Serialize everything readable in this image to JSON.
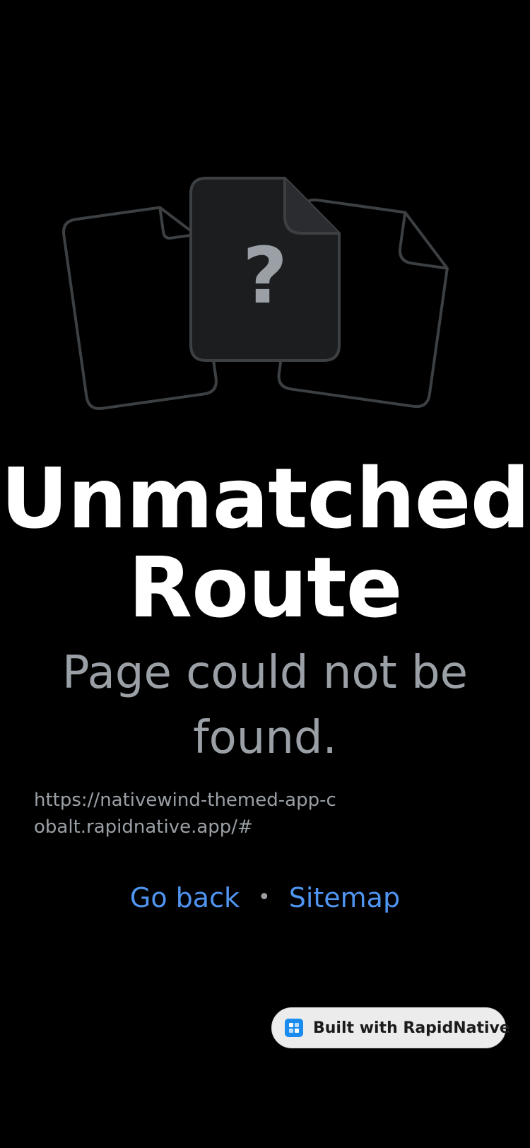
{
  "illustration": {
    "icon": "unknown-file-icon",
    "glyph": "?",
    "colors": {
      "stroke": "#3c4043",
      "fill": "#1c1d1f",
      "glyph": "#9aa0a6"
    }
  },
  "title": {
    "line1": "Unmatched",
    "line2": "Route"
  },
  "subtitle": "Page could not be found.",
  "url": "https://nativewind-themed-app-cobalt.rapidnative.app/#",
  "links": {
    "go_back": "Go back",
    "separator": "•",
    "sitemap": "Sitemap",
    "color": "#4f94ef"
  },
  "badge": {
    "icon": "rapidnative-logo-icon",
    "label": "Built with RapidNative"
  }
}
